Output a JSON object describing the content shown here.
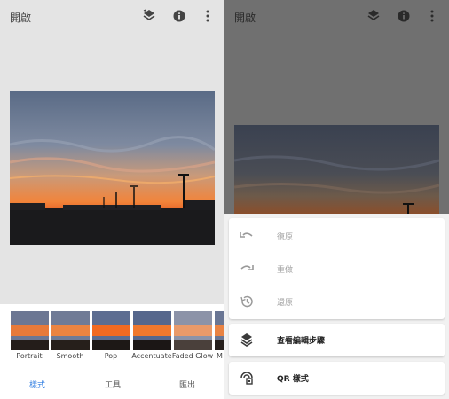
{
  "left": {
    "title": "開啟",
    "icons": [
      "layers-icon",
      "info-icon",
      "more-vert-icon"
    ],
    "styles": [
      {
        "label": "Portrait"
      },
      {
        "label": "Smooth"
      },
      {
        "label": "Pop"
      },
      {
        "label": "Accentuate"
      },
      {
        "label": "Faded Glow"
      },
      {
        "label": "M"
      }
    ],
    "nav": [
      {
        "label": "樣式",
        "active": true
      },
      {
        "label": "工具",
        "active": false
      },
      {
        "label": "匯出",
        "active": false
      }
    ]
  },
  "right": {
    "title": "開啟",
    "menu": {
      "undo": {
        "label": "復原",
        "icon": "undo-icon"
      },
      "redo": {
        "label": "重做",
        "icon": "redo-icon"
      },
      "revert": {
        "label": "還原",
        "icon": "history-icon"
      },
      "view_edits": {
        "label": "查看編輯步驟",
        "icon": "layers-icon"
      },
      "qr_style": {
        "label": "QR 樣式",
        "icon": "qr-style-icon"
      }
    }
  },
  "colors": {
    "accent": "#2f7de1",
    "background": "#e4e4e4",
    "overlay": "#707070"
  }
}
